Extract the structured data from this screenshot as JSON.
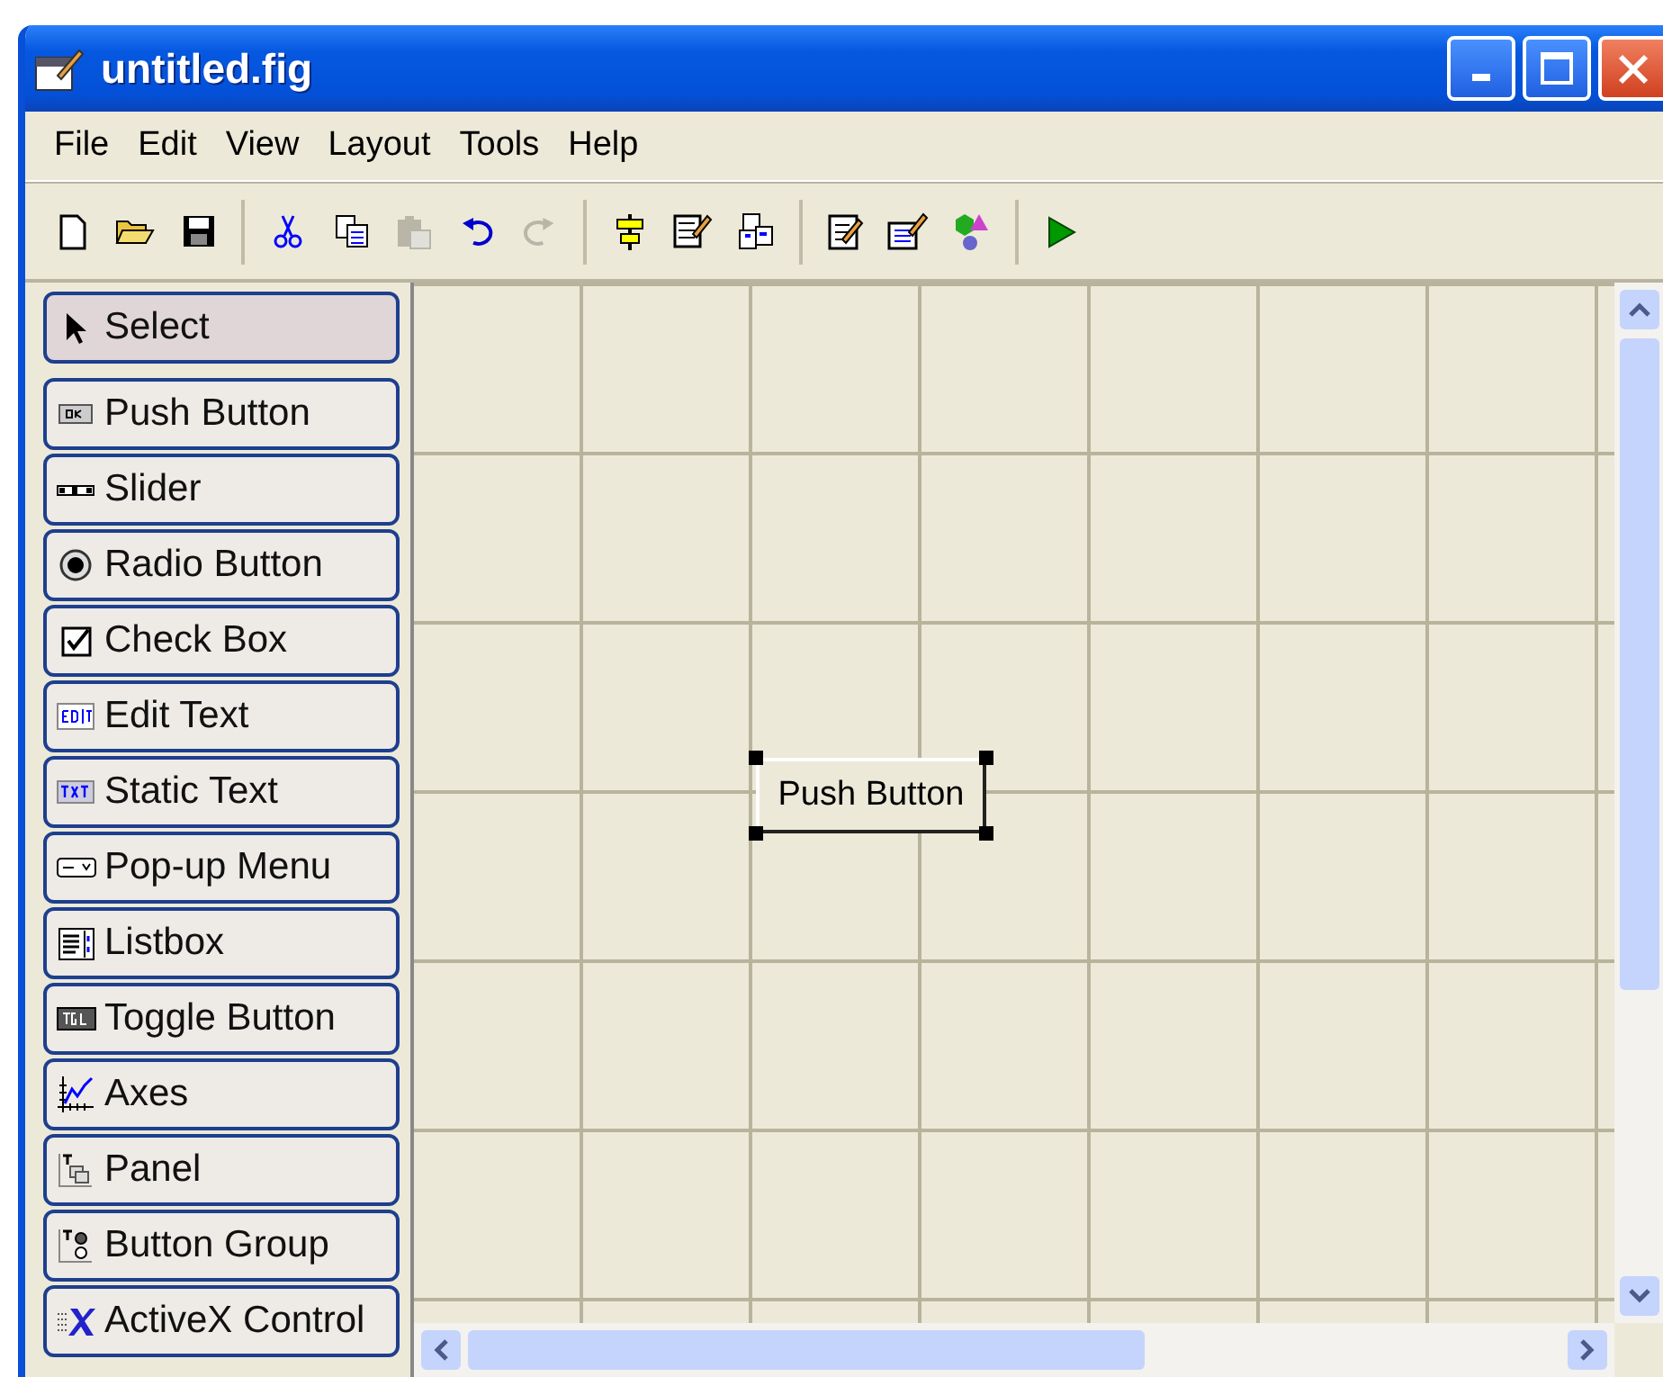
{
  "window": {
    "title": "untitled.fig"
  },
  "menu": [
    "File",
    "Edit",
    "View",
    "Layout",
    "Tools",
    "Help"
  ],
  "toolbar": [
    [
      {
        "kind": "new",
        "disabled": false
      },
      {
        "kind": "open",
        "disabled": false
      },
      {
        "kind": "save",
        "disabled": false
      }
    ],
    [
      {
        "kind": "cut",
        "disabled": false
      },
      {
        "kind": "copy",
        "disabled": false
      },
      {
        "kind": "paste",
        "disabled": true
      },
      {
        "kind": "undo",
        "disabled": false
      },
      {
        "kind": "redo",
        "disabled": true
      }
    ],
    [
      {
        "kind": "align",
        "disabled": false
      },
      {
        "kind": "menu_editor",
        "disabled": false
      },
      {
        "kind": "tab_order",
        "disabled": false
      }
    ],
    [
      {
        "kind": "editor",
        "disabled": false
      },
      {
        "kind": "inspector",
        "disabled": false
      },
      {
        "kind": "browser",
        "disabled": false
      }
    ],
    [
      {
        "kind": "run",
        "disabled": false
      }
    ]
  ],
  "palette": [
    {
      "kind": "select",
      "label": "Select",
      "selected": true
    },
    {
      "kind": "push",
      "label": "Push Button",
      "selected": false
    },
    {
      "kind": "slider",
      "label": "Slider",
      "selected": false
    },
    {
      "kind": "radio",
      "label": "Radio Button",
      "selected": false
    },
    {
      "kind": "check",
      "label": "Check Box",
      "selected": false
    },
    {
      "kind": "edit",
      "label": "Edit Text",
      "selected": false
    },
    {
      "kind": "static",
      "label": "Static Text",
      "selected": false
    },
    {
      "kind": "popup",
      "label": "Pop-up Menu",
      "selected": false
    },
    {
      "kind": "list",
      "label": "Listbox",
      "selected": false
    },
    {
      "kind": "toggle",
      "label": "Toggle Button",
      "selected": false
    },
    {
      "kind": "axes",
      "label": "Axes",
      "selected": false
    },
    {
      "kind": "panel",
      "label": "Panel",
      "selected": false
    },
    {
      "kind": "group",
      "label": "Button Group",
      "selected": false
    },
    {
      "kind": "activex",
      "label": "ActiveX Control",
      "selected": false
    }
  ],
  "canvas": {
    "components": [
      {
        "kind": "push",
        "label": "Push Button",
        "selected": true
      }
    ]
  }
}
